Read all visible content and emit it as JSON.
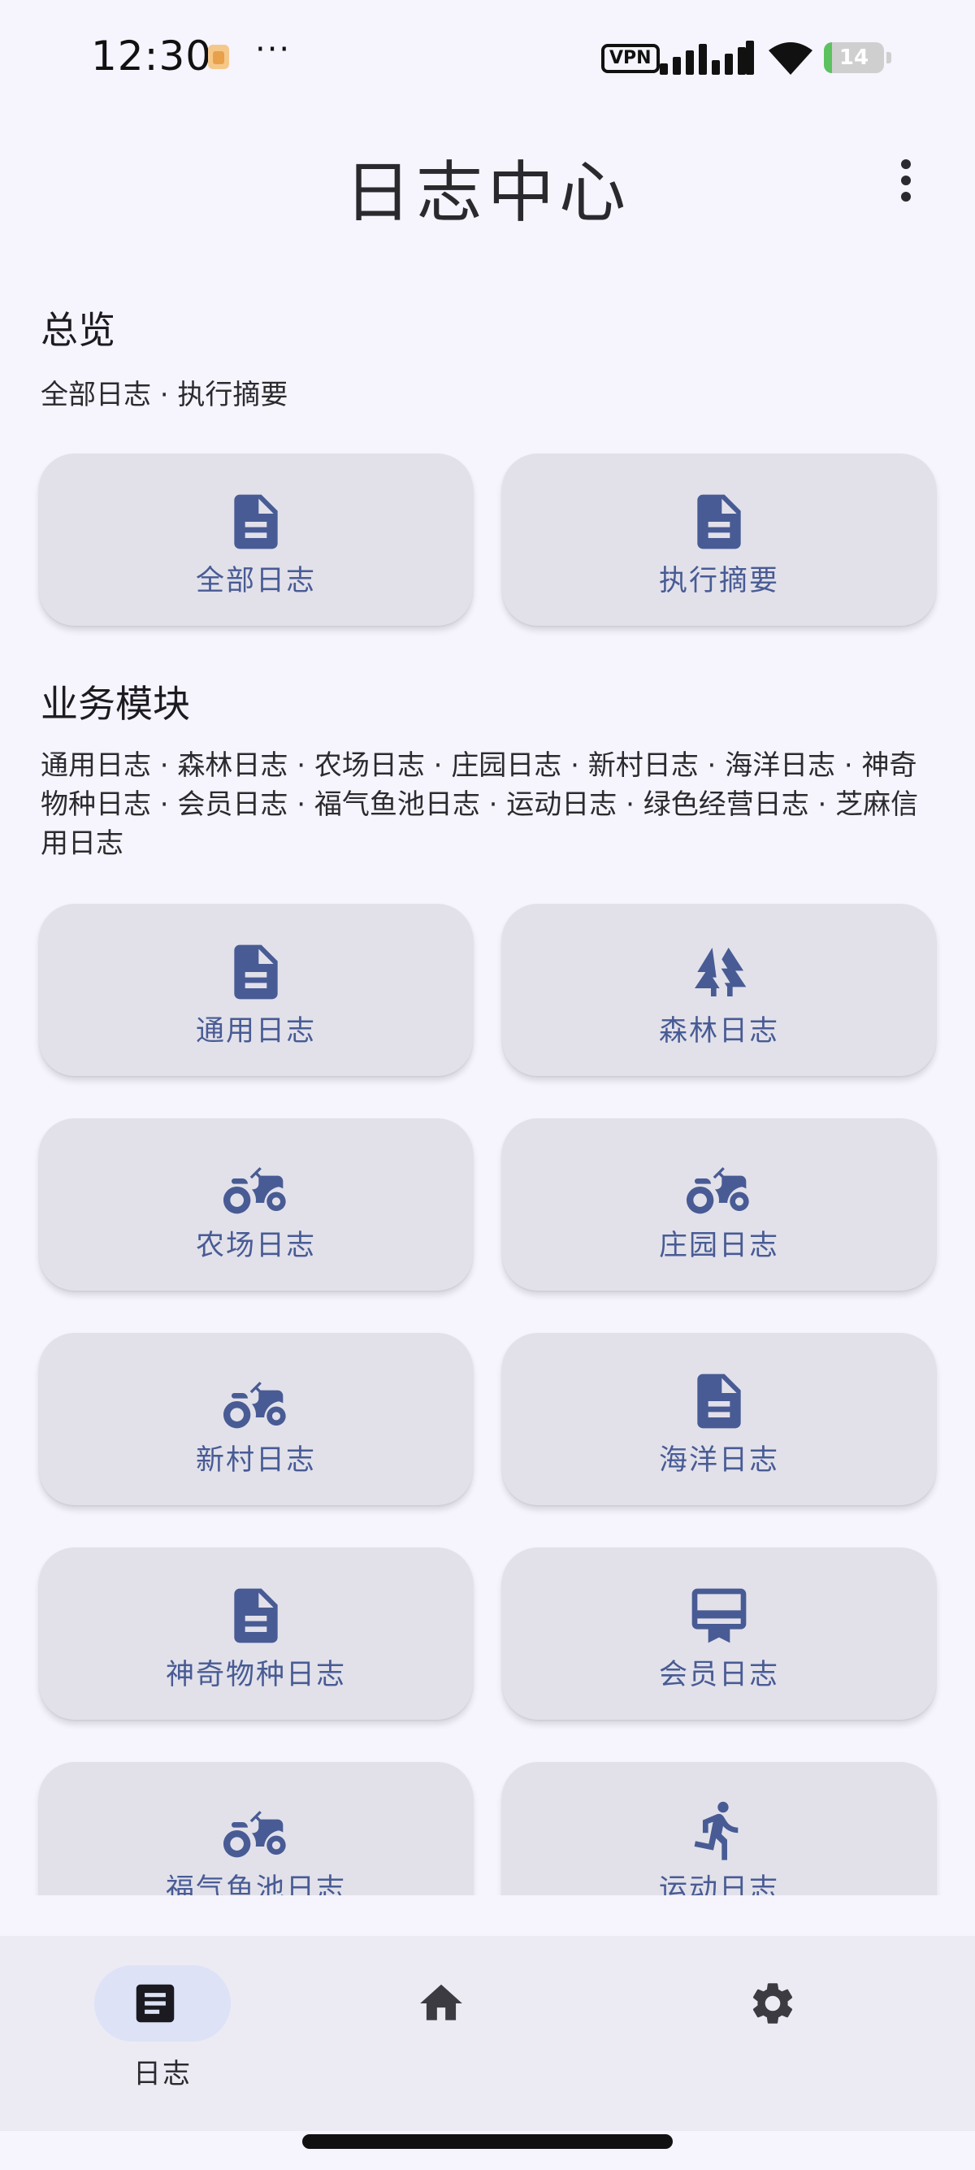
{
  "status_bar": {
    "time": "12:30",
    "more": "···",
    "vpn": "VPN",
    "battery": "14",
    "battery_level": 0.14
  },
  "header": {
    "title": "日志中心",
    "menu_icon": "more-vert-icon"
  },
  "overview": {
    "title": "总览",
    "subtitle": "全部日志 · 执行摘要",
    "cards": [
      {
        "label": "全部日志",
        "icon": "description-icon"
      },
      {
        "label": "执行摘要",
        "icon": "description-icon"
      }
    ]
  },
  "modules": {
    "title": "业务模块",
    "subtitle": "通用日志 · 森林日志 · 农场日志 · 庄园日志 · 新村日志 · 海洋日志 · 神奇物种日志 · 会员日志 · 福气鱼池日志 · 运动日志 · 绿色经营日志 · 芝麻信用日志",
    "cards": [
      {
        "label": "通用日志",
        "icon": "description-icon"
      },
      {
        "label": "森林日志",
        "icon": "forest-icon"
      },
      {
        "label": "农场日志",
        "icon": "tractor-icon"
      },
      {
        "label": "庄园日志",
        "icon": "tractor-icon"
      },
      {
        "label": "新村日志",
        "icon": "tractor-icon"
      },
      {
        "label": "海洋日志",
        "icon": "description-icon"
      },
      {
        "label": "神奇物种日志",
        "icon": "description-icon"
      },
      {
        "label": "会员日志",
        "icon": "card-membership-icon"
      },
      {
        "label": "福气鱼池日志",
        "icon": "tractor-icon"
      },
      {
        "label": "运动日志",
        "icon": "directions-run-icon"
      }
    ]
  },
  "bottom_nav": {
    "items": [
      {
        "label": "日志",
        "icon": "article-icon",
        "selected": true
      },
      {
        "label": "",
        "icon": "home-icon",
        "selected": false
      },
      {
        "label": "",
        "icon": "settings-icon",
        "selected": false
      }
    ]
  },
  "colors": {
    "background": "#f6f4fc",
    "card": "#e2e1ea",
    "accent": "#485b94",
    "nav_background": "#ecebf4",
    "nav_pill": "#dde2f6"
  }
}
